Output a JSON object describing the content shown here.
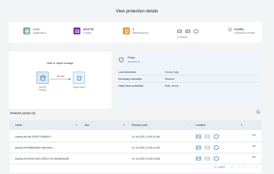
{
  "page": {
    "title": "View protection details"
  },
  "summary": {
    "application": {
      "value": "mtnix",
      "label": "Application",
      "color": "#6fa287"
    },
    "cluster": {
      "value": "skv3725",
      "label": "Cluster",
      "color": "#7a2ea6"
    },
    "namespaces": {
      "value": "1",
      "label": "Namespaces",
      "color": "#e8923a"
    },
    "location": {
      "label": "Location"
    },
    "health": {
      "value": "Healthy",
      "label": "Protection health",
      "color": "#48a05a"
    }
  },
  "storage": {
    "heading": "Disk to object storage",
    "source_label": "ONTAP",
    "source_sub": "Primary",
    "arrow_label": "Backup",
    "target_label": "Object Store"
  },
  "policy": {
    "title": "Policy",
    "name": "aw-mtnix-11",
    "rows": [
      {
        "key": "Local schedules",
        "value": "Hourly, Daily"
      },
      {
        "key": "Secondary schedules",
        "value": "Disabled"
      },
      {
        "key": "Object store schedules",
        "value": "Daily, Hourly"
      }
    ]
  },
  "restore": {
    "title": "Restore points (3)",
    "columns": {
      "name": "Name",
      "size": "Size",
      "point": "Restore point",
      "location": "Location"
    },
    "rows": [
      {
        "name": "custom-ee7a6-20250724080513",
        "size": "",
        "point": "24 Jul 2025, 11:00:12 AM"
      },
      {
        "name": "backup-e37f0868-8b0e-4d6f-9ee0-...",
        "size": "",
        "point": "24 Jul 2025, 10:45:13 AM"
      },
      {
        "name": "backup-e97a00e2-5bf1-4296-b71b-b6c3f6d4a26f",
        "size": "",
        "point": "24 Jul 2025, 10:08:13 AM"
      }
    ],
    "pagination": "1 – 3 of 3"
  },
  "colors": {
    "accent": "#1f6fb0",
    "location_icon": "#1f6fb0"
  }
}
